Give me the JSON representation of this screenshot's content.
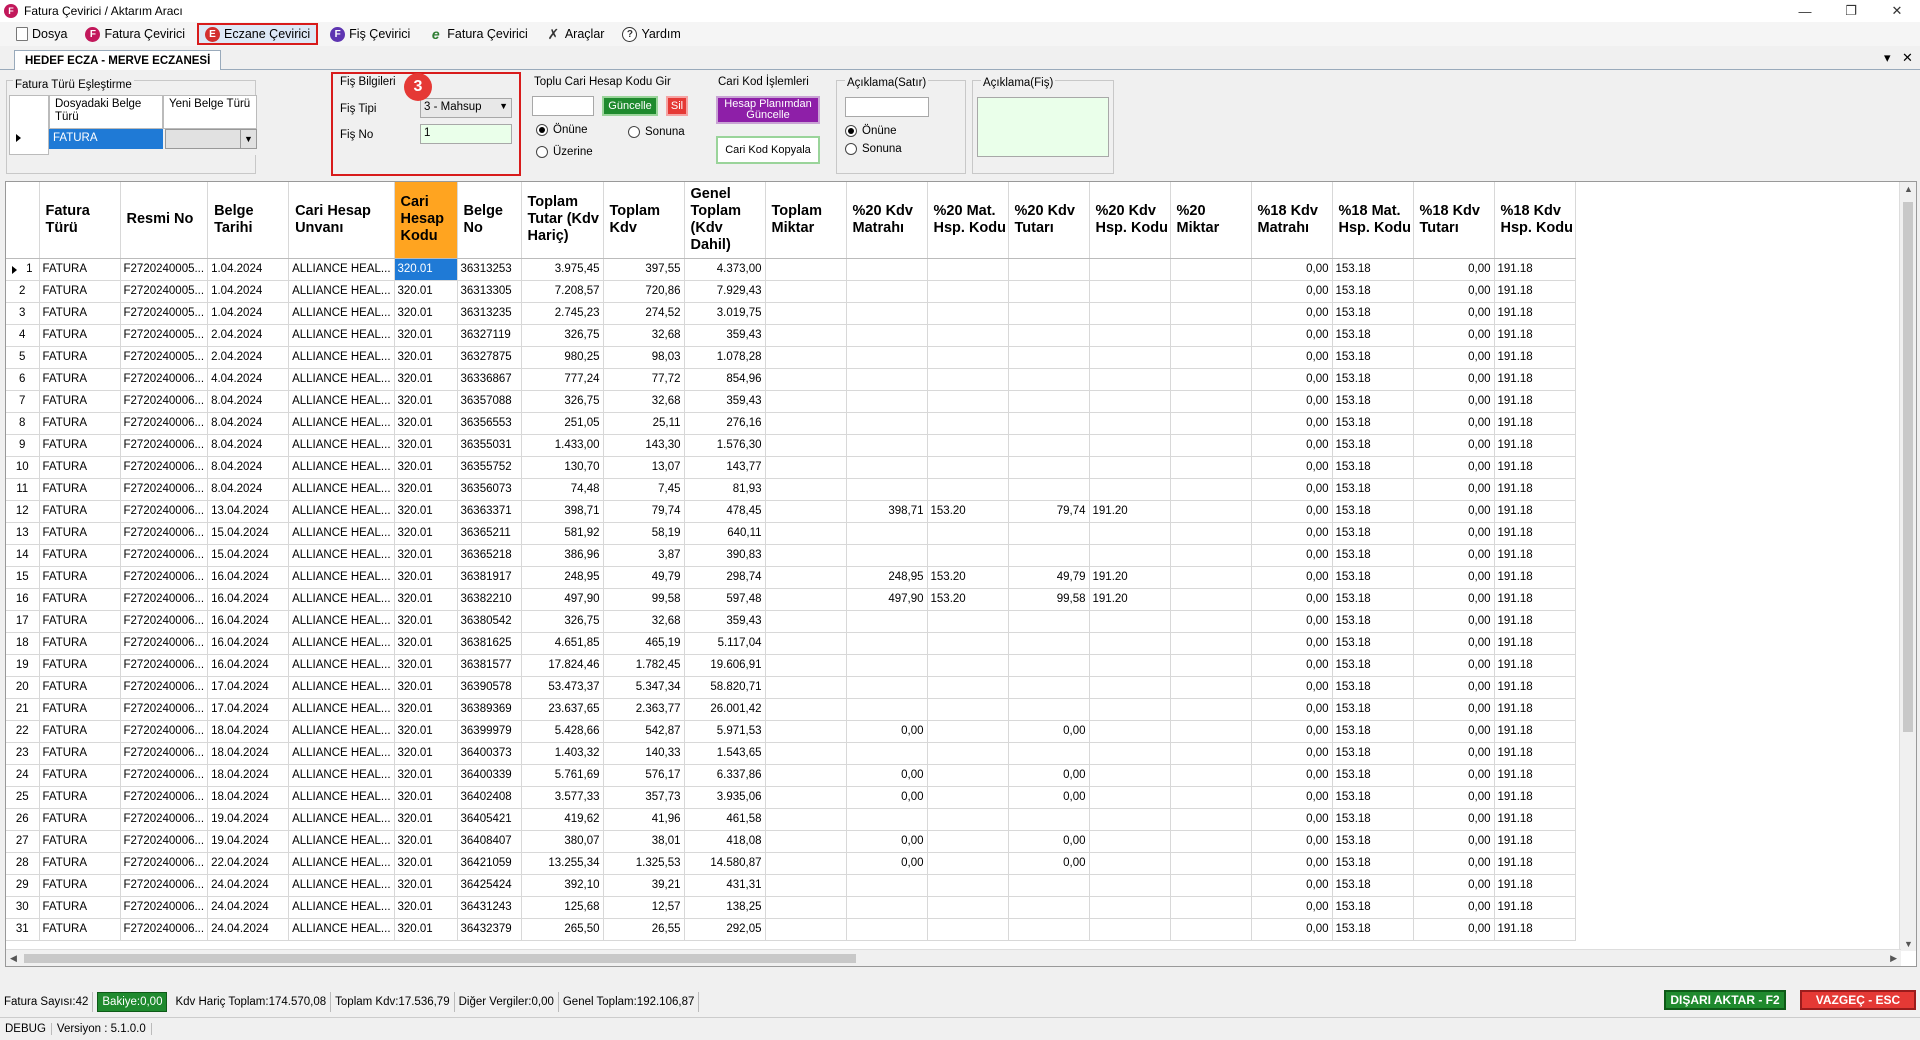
{
  "window": {
    "title": "Fatura Çevirici / Aktarım Aracı",
    "icon_letter": "F",
    "controls": [
      "—",
      "❐",
      "✕"
    ]
  },
  "menu": [
    {
      "label": "Dosya",
      "icon": "document-icon",
      "glyph": "",
      "style": "doc"
    },
    {
      "label": "Fatura Çevirici",
      "icon": "f-badge-icon",
      "glyph": "F",
      "style": "pink"
    },
    {
      "label": "Eczane Çevirici",
      "icon": "e-badge-icon",
      "glyph": "E",
      "style": "red",
      "active": true
    },
    {
      "label": "Fiş Çevirici",
      "icon": "f-badge-purple-icon",
      "glyph": "F",
      "style": "purple"
    },
    {
      "label": "Fatura Çevirici",
      "icon": "e-script-icon",
      "glyph": "e",
      "style": "plain"
    },
    {
      "label": "Araçlar",
      "icon": "tools-icon",
      "glyph": "✗",
      "style": "tools"
    },
    {
      "label": "Yardım",
      "icon": "help-icon",
      "glyph": "?",
      "style": "help"
    }
  ],
  "tab": {
    "title": "HEDEF ECZA - MERVE ECZANESİ",
    "dropdown": "▾",
    "close": "✕"
  },
  "fatura_turu": {
    "title": "Fatura Türü Eşleştirme",
    "col1": "Dosyadaki Belge Türü",
    "col2": "Yeni Belge Türü",
    "row_value": "FATURA"
  },
  "fis": {
    "title": "Fiş Bilgileri",
    "tipi_label": "Fiş Tipi",
    "tipi_value": "3 - Mahsup",
    "no_label": "Fiş No",
    "no_value": "1",
    "step_marker": "3"
  },
  "toplu": {
    "title": "Toplu Cari Hesap Kodu Gir",
    "update_btn": "Güncelle",
    "delete_btn": "Sil",
    "opt1": "Önüne",
    "opt2": "Sonuna",
    "opt3": "Üzerine"
  },
  "cari_kod": {
    "title": "Cari Kod İşlemleri",
    "plan_btn": "Hesap Planımdan Güncelle",
    "copy_btn": "Cari Kod Kopyala"
  },
  "aciklama_satir": {
    "title": "Açıklama(Satır)",
    "opt1": "Önüne",
    "opt2": "Sonuna"
  },
  "aciklama_fis": {
    "title": "Açıklama(Fiş)"
  },
  "columns": [
    "Fatura Türü",
    "Resmi No",
    "Belge Tarihi",
    "Cari Hesap Unvanı",
    "Cari Hesap Kodu",
    "Belge No",
    "Toplam Tutar (Kdv Hariç)",
    "Toplam Kdv",
    "Genel Toplam (Kdv Dahil)",
    "Toplam Miktar",
    "%20 Kdv Matrahı",
    "%20 Mat. Hsp. Kodu",
    "%20 Kdv Tutarı",
    "%20 Kdv Hsp. Kodu",
    "%20 Miktar",
    "%18 Kdv Matrahı",
    "%18 Mat. Hsp. Kodu",
    "%18 Kdv Tutarı",
    "%18 Kdv Hsp. Kodu"
  ],
  "rows": [
    [
      "1",
      "FATURA",
      "F2720240005...",
      "1.04.2024",
      "ALLIANCE HEAL...",
      "320.01",
      "36313253",
      "3.975,45",
      "397,55",
      "4.373,00",
      "",
      "",
      "",
      "",
      "",
      "",
      "0,00",
      "153.18",
      "0,00",
      "191.18"
    ],
    [
      "2",
      "FATURA",
      "F2720240005...",
      "1.04.2024",
      "ALLIANCE HEAL...",
      "320.01",
      "36313305",
      "7.208,57",
      "720,86",
      "7.929,43",
      "",
      "",
      "",
      "",
      "",
      "",
      "0,00",
      "153.18",
      "0,00",
      "191.18"
    ],
    [
      "3",
      "FATURA",
      "F2720240005...",
      "1.04.2024",
      "ALLIANCE HEAL...",
      "320.01",
      "36313235",
      "2.745,23",
      "274,52",
      "3.019,75",
      "",
      "",
      "",
      "",
      "",
      "",
      "0,00",
      "153.18",
      "0,00",
      "191.18"
    ],
    [
      "4",
      "FATURA",
      "F2720240005...",
      "2.04.2024",
      "ALLIANCE HEAL...",
      "320.01",
      "36327119",
      "326,75",
      "32,68",
      "359,43",
      "",
      "",
      "",
      "",
      "",
      "",
      "0,00",
      "153.18",
      "0,00",
      "191.18"
    ],
    [
      "5",
      "FATURA",
      "F2720240005...",
      "2.04.2024",
      "ALLIANCE HEAL...",
      "320.01",
      "36327875",
      "980,25",
      "98,03",
      "1.078,28",
      "",
      "",
      "",
      "",
      "",
      "",
      "0,00",
      "153.18",
      "0,00",
      "191.18"
    ],
    [
      "6",
      "FATURA",
      "F2720240006...",
      "4.04.2024",
      "ALLIANCE HEAL...",
      "320.01",
      "36336867",
      "777,24",
      "77,72",
      "854,96",
      "",
      "",
      "",
      "",
      "",
      "",
      "0,00",
      "153.18",
      "0,00",
      "191.18"
    ],
    [
      "7",
      "FATURA",
      "F2720240006...",
      "8.04.2024",
      "ALLIANCE HEAL...",
      "320.01",
      "36357088",
      "326,75",
      "32,68",
      "359,43",
      "",
      "",
      "",
      "",
      "",
      "",
      "0,00",
      "153.18",
      "0,00",
      "191.18"
    ],
    [
      "8",
      "FATURA",
      "F2720240006...",
      "8.04.2024",
      "ALLIANCE HEAL...",
      "320.01",
      "36356553",
      "251,05",
      "25,11",
      "276,16",
      "",
      "",
      "",
      "",
      "",
      "",
      "0,00",
      "153.18",
      "0,00",
      "191.18"
    ],
    [
      "9",
      "FATURA",
      "F2720240006...",
      "8.04.2024",
      "ALLIANCE HEAL...",
      "320.01",
      "36355031",
      "1.433,00",
      "143,30",
      "1.576,30",
      "",
      "",
      "",
      "",
      "",
      "",
      "0,00",
      "153.18",
      "0,00",
      "191.18"
    ],
    [
      "10",
      "FATURA",
      "F2720240006...",
      "8.04.2024",
      "ALLIANCE HEAL...",
      "320.01",
      "36355752",
      "130,70",
      "13,07",
      "143,77",
      "",
      "",
      "",
      "",
      "",
      "",
      "0,00",
      "153.18",
      "0,00",
      "191.18"
    ],
    [
      "11",
      "FATURA",
      "F2720240006...",
      "8.04.2024",
      "ALLIANCE HEAL...",
      "320.01",
      "36356073",
      "74,48",
      "7,45",
      "81,93",
      "",
      "",
      "",
      "",
      "",
      "",
      "0,00",
      "153.18",
      "0,00",
      "191.18"
    ],
    [
      "12",
      "FATURA",
      "F2720240006...",
      "13.04.2024",
      "ALLIANCE HEAL...",
      "320.01",
      "36363371",
      "398,71",
      "79,74",
      "478,45",
      "",
      "398,71",
      "153.20",
      "79,74",
      "191.20",
      "",
      "0,00",
      "153.18",
      "0,00",
      "191.18"
    ],
    [
      "13",
      "FATURA",
      "F2720240006...",
      "15.04.2024",
      "ALLIANCE HEAL...",
      "320.01",
      "36365211",
      "581,92",
      "58,19",
      "640,11",
      "",
      "",
      "",
      "",
      "",
      "",
      "0,00",
      "153.18",
      "0,00",
      "191.18"
    ],
    [
      "14",
      "FATURA",
      "F2720240006...",
      "15.04.2024",
      "ALLIANCE HEAL...",
      "320.01",
      "36365218",
      "386,96",
      "3,87",
      "390,83",
      "",
      "",
      "",
      "",
      "",
      "",
      "0,00",
      "153.18",
      "0,00",
      "191.18"
    ],
    [
      "15",
      "FATURA",
      "F2720240006...",
      "16.04.2024",
      "ALLIANCE HEAL...",
      "320.01",
      "36381917",
      "248,95",
      "49,79",
      "298,74",
      "",
      "248,95",
      "153.20",
      "49,79",
      "191.20",
      "",
      "0,00",
      "153.18",
      "0,00",
      "191.18"
    ],
    [
      "16",
      "FATURA",
      "F2720240006...",
      "16.04.2024",
      "ALLIANCE HEAL...",
      "320.01",
      "36382210",
      "497,90",
      "99,58",
      "597,48",
      "",
      "497,90",
      "153.20",
      "99,58",
      "191.20",
      "",
      "0,00",
      "153.18",
      "0,00",
      "191.18"
    ],
    [
      "17",
      "FATURA",
      "F2720240006...",
      "16.04.2024",
      "ALLIANCE HEAL...",
      "320.01",
      "36380542",
      "326,75",
      "32,68",
      "359,43",
      "",
      "",
      "",
      "",
      "",
      "",
      "0,00",
      "153.18",
      "0,00",
      "191.18"
    ],
    [
      "18",
      "FATURA",
      "F2720240006...",
      "16.04.2024",
      "ALLIANCE HEAL...",
      "320.01",
      "36381625",
      "4.651,85",
      "465,19",
      "5.117,04",
      "",
      "",
      "",
      "",
      "",
      "",
      "0,00",
      "153.18",
      "0,00",
      "191.18"
    ],
    [
      "19",
      "FATURA",
      "F2720240006...",
      "16.04.2024",
      "ALLIANCE HEAL...",
      "320.01",
      "36381577",
      "17.824,46",
      "1.782,45",
      "19.606,91",
      "",
      "",
      "",
      "",
      "",
      "",
      "0,00",
      "153.18",
      "0,00",
      "191.18"
    ],
    [
      "20",
      "FATURA",
      "F2720240006...",
      "17.04.2024",
      "ALLIANCE HEAL...",
      "320.01",
      "36390578",
      "53.473,37",
      "5.347,34",
      "58.820,71",
      "",
      "",
      "",
      "",
      "",
      "",
      "0,00",
      "153.18",
      "0,00",
      "191.18"
    ],
    [
      "21",
      "FATURA",
      "F2720240006...",
      "17.04.2024",
      "ALLIANCE HEAL...",
      "320.01",
      "36389369",
      "23.637,65",
      "2.363,77",
      "26.001,42",
      "",
      "",
      "",
      "",
      "",
      "",
      "0,00",
      "153.18",
      "0,00",
      "191.18"
    ],
    [
      "22",
      "FATURA",
      "F2720240006...",
      "18.04.2024",
      "ALLIANCE HEAL...",
      "320.01",
      "36399979",
      "5.428,66",
      "542,87",
      "5.971,53",
      "",
      "0,00",
      "",
      "0,00",
      "",
      "",
      "0,00",
      "153.18",
      "0,00",
      "191.18"
    ],
    [
      "23",
      "FATURA",
      "F2720240006...",
      "18.04.2024",
      "ALLIANCE HEAL...",
      "320.01",
      "36400373",
      "1.403,32",
      "140,33",
      "1.543,65",
      "",
      "",
      "",
      "",
      "",
      "",
      "0,00",
      "153.18",
      "0,00",
      "191.18"
    ],
    [
      "24",
      "FATURA",
      "F2720240006...",
      "18.04.2024",
      "ALLIANCE HEAL...",
      "320.01",
      "36400339",
      "5.761,69",
      "576,17",
      "6.337,86",
      "",
      "0,00",
      "",
      "0,00",
      "",
      "",
      "0,00",
      "153.18",
      "0,00",
      "191.18"
    ],
    [
      "25",
      "FATURA",
      "F2720240006...",
      "18.04.2024",
      "ALLIANCE HEAL...",
      "320.01",
      "36402408",
      "3.577,33",
      "357,73",
      "3.935,06",
      "",
      "0,00",
      "",
      "0,00",
      "",
      "",
      "0,00",
      "153.18",
      "0,00",
      "191.18"
    ],
    [
      "26",
      "FATURA",
      "F2720240006...",
      "19.04.2024",
      "ALLIANCE HEAL...",
      "320.01",
      "36405421",
      "419,62",
      "41,96",
      "461,58",
      "",
      "",
      "",
      "",
      "",
      "",
      "0,00",
      "153.18",
      "0,00",
      "191.18"
    ],
    [
      "27",
      "FATURA",
      "F2720240006...",
      "19.04.2024",
      "ALLIANCE HEAL...",
      "320.01",
      "36408407",
      "380,07",
      "38,01",
      "418,08",
      "",
      "0,00",
      "",
      "0,00",
      "",
      "",
      "0,00",
      "153.18",
      "0,00",
      "191.18"
    ],
    [
      "28",
      "FATURA",
      "F2720240006...",
      "22.04.2024",
      "ALLIANCE HEAL...",
      "320.01",
      "36421059",
      "13.255,34",
      "1.325,53",
      "14.580,87",
      "",
      "0,00",
      "",
      "0,00",
      "",
      "",
      "0,00",
      "153.18",
      "0,00",
      "191.18"
    ],
    [
      "29",
      "FATURA",
      "F2720240006...",
      "24.04.2024",
      "ALLIANCE HEAL...",
      "320.01",
      "36425424",
      "392,10",
      "39,21",
      "431,31",
      "",
      "",
      "",
      "",
      "",
      "",
      "0,00",
      "153.18",
      "0,00",
      "191.18"
    ],
    [
      "30",
      "FATURA",
      "F2720240006...",
      "24.04.2024",
      "ALLIANCE HEAL...",
      "320.01",
      "36431243",
      "125,68",
      "12,57",
      "138,25",
      "",
      "",
      "",
      "",
      "",
      "",
      "0,00",
      "153.18",
      "0,00",
      "191.18"
    ],
    [
      "31",
      "FATURA",
      "F2720240006...",
      "24.04.2024",
      "ALLIANCE HEAL...",
      "320.01",
      "36432379",
      "265,50",
      "26,55",
      "292,05",
      "",
      "",
      "",
      "",
      "",
      "",
      "0,00",
      "153.18",
      "0,00",
      "191.18"
    ]
  ],
  "status": {
    "fatura_sayisi": "Fatura Sayısı:42",
    "bakiye": "Bakiye:0,00",
    "kdv_haric": "Kdv Hariç Toplam:174.570,08",
    "toplam_kdv": "Toplam Kdv:17.536,79",
    "diger": "Diğer Vergiler:0,00",
    "genel": "Genel Toplam:192.106,87",
    "export_btn": "DIŞARI AKTAR - F2",
    "cancel_btn": "VAZGEÇ - ESC"
  },
  "footer": {
    "mode": "DEBUG",
    "version": "Versiyon : 5.1.0.0"
  },
  "colors": {
    "accent_orange": "#ffa420",
    "selection_blue": "#1f7ad6",
    "export_green": "#1f8a2e",
    "cancel_red": "#e53935",
    "highlight_red": "#d81b1b"
  }
}
